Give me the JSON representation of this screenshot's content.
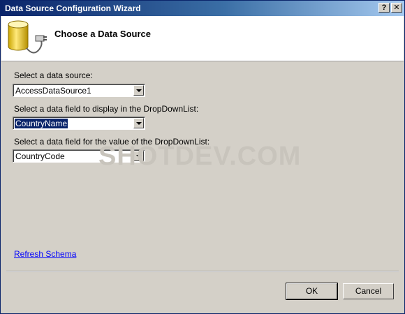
{
  "window": {
    "title": "Data Source Configuration Wizard",
    "help_label": "?",
    "close_label": "✕"
  },
  "header": {
    "title": "Choose a Data Source",
    "icon": "database-plug-icon"
  },
  "form": {
    "data_source": {
      "label": "Select a data source:",
      "value": "AccessDataSource1"
    },
    "display_field": {
      "label": "Select a data field to display in the DropDownList:",
      "value": "CountryName"
    },
    "value_field": {
      "label": "Select a data field for the value of the DropDownList:",
      "value": "CountryCode"
    }
  },
  "watermark": "SHOTDEV.COM",
  "links": {
    "refresh_schema": "Refresh Schema"
  },
  "buttons": {
    "ok": "OK",
    "cancel": "Cancel"
  }
}
